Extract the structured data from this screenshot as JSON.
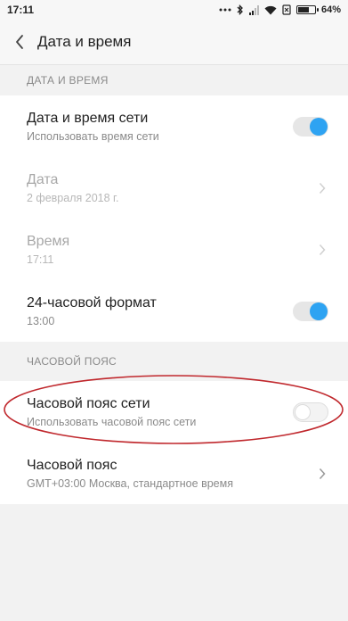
{
  "status_bar": {
    "time": "17:11",
    "battery": "64%"
  },
  "header": {
    "title": "Дата и время"
  },
  "sections": [
    {
      "header": "ДАТА И ВРЕМЯ",
      "rows": [
        {
          "title": "Дата и время сети",
          "subtitle": "Использовать время сети",
          "control": "toggle",
          "state": "on",
          "enabled": true
        },
        {
          "title": "Дата",
          "subtitle": "2 февраля 2018 г.",
          "control": "chevron",
          "enabled": false
        },
        {
          "title": "Время",
          "subtitle": "17:11",
          "control": "chevron",
          "enabled": false
        },
        {
          "title": "24-часовой формат",
          "subtitle": "13:00",
          "control": "toggle",
          "state": "on",
          "enabled": true
        }
      ]
    },
    {
      "header": "ЧАСОВОЙ ПОЯС",
      "rows": [
        {
          "title": "Часовой пояс сети",
          "subtitle": "Использовать часовой пояс сети",
          "control": "toggle",
          "state": "off",
          "enabled": true
        },
        {
          "title": "Часовой пояс",
          "subtitle": "GMT+03:00 Москва, стандартное время",
          "control": "chevron",
          "enabled": true
        }
      ]
    }
  ],
  "colors": {
    "accent": "#2ea3f2",
    "annotation": "#c0282d",
    "background": "#f2f2f2"
  }
}
